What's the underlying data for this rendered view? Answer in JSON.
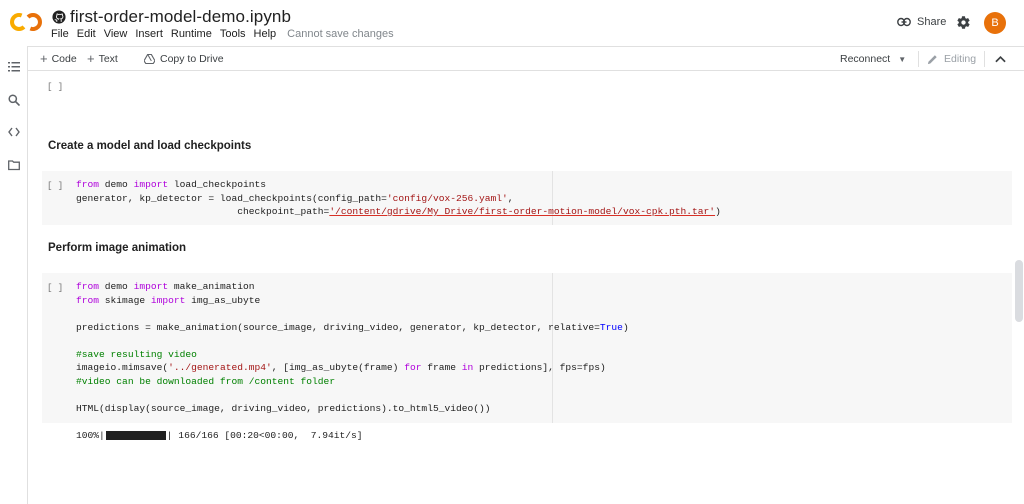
{
  "header": {
    "notebook_title": "first-order-model-demo.ipynb",
    "menu": [
      "File",
      "Edit",
      "View",
      "Insert",
      "Runtime",
      "Tools",
      "Help"
    ],
    "save_note": "Cannot save changes",
    "share_label": "Share",
    "avatar_letter": "B"
  },
  "toolbar": {
    "code_label": "Code",
    "text_label": "Text",
    "copy_label": "Copy to Drive",
    "reconnect_label": "Reconnect",
    "editing_label": "Editing"
  },
  "rail": {
    "icons": [
      "toc-icon",
      "search-icon",
      "code-snippets-icon",
      "folder-icon"
    ]
  },
  "cells": {
    "run_marker": "[ ]",
    "heading_1": "Create a model and load checkpoints",
    "heading_2": "Perform image animation",
    "output": {
      "percent": "100%|",
      "progress_fraction": 1.0,
      "tail": "| 166/166 [00:20<00:00,  7.94it/s]"
    }
  },
  "colors": {
    "accent_orange": "#e8710a",
    "logo_orange": "#f9ab00",
    "keyword": "#af00db",
    "string": "#a31515",
    "comment": "#008000"
  }
}
